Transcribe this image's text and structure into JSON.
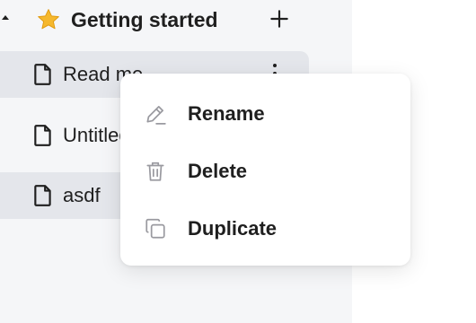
{
  "sidebar": {
    "folder": {
      "icon": "star-icon",
      "title": "Getting started",
      "add_icon": "plus-icon"
    },
    "pages": [
      {
        "label": "Read me",
        "icon": "document-icon",
        "selected": true
      },
      {
        "label": "Untitled",
        "icon": "document-icon",
        "selected": false
      },
      {
        "label": "asdf",
        "icon": "document-icon",
        "selected": true
      }
    ]
  },
  "context_menu": {
    "items": [
      {
        "label": "Rename",
        "icon": "pencil-icon"
      },
      {
        "label": "Delete",
        "icon": "trash-icon"
      },
      {
        "label": "Duplicate",
        "icon": "duplicate-icon"
      }
    ]
  },
  "colors": {
    "sidebar_bg": "#f5f6f8",
    "selected_bg": "#e4e6eb",
    "star": "#f5b82e",
    "icon_muted": "#9a9aa0",
    "text": "#1f1f1f"
  }
}
